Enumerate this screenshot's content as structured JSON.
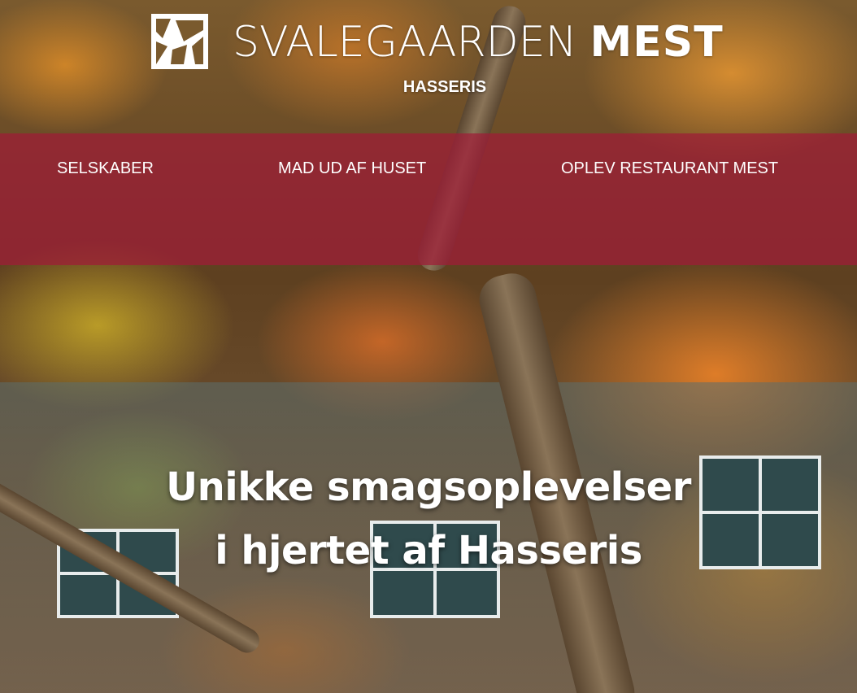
{
  "header": {
    "brand_light": "SVALEGAARDEN",
    "brand_bold": "MEST",
    "location": "HASSERIS"
  },
  "nav": {
    "items": [
      {
        "label": "SELSKABER"
      },
      {
        "label": "MAD UD AF HUSET"
      },
      {
        "label": "OPLEV RESTAURANT MEST"
      }
    ]
  },
  "hero": {
    "line1": "Unikke smagsoplevelser",
    "line2": "i hjertet af Hasseris"
  },
  "colors": {
    "nav_band": "#a01c38",
    "text": "#ffffff"
  },
  "icons": {
    "logo": "svalegaarden-logo-icon"
  }
}
